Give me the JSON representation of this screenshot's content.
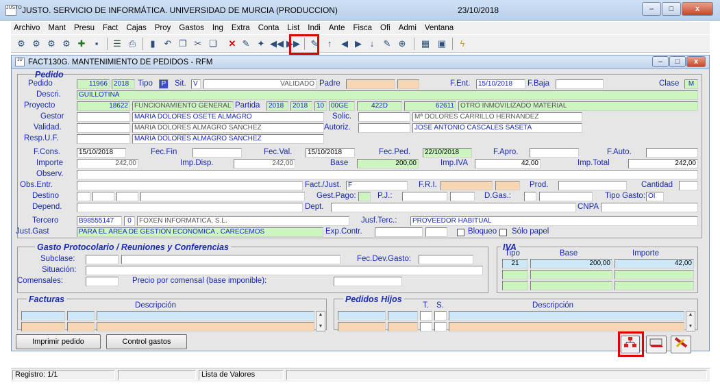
{
  "window": {
    "title": "JUSTO. SERVICIO DE INFORMÁTICA. UNIVERSIDAD DE MURCIA (PRODUCCION)",
    "date": "23/10/2018",
    "app_icon_text": "JUSTO",
    "minimize": "–",
    "maximize": "□",
    "close": "x"
  },
  "menu": [
    "Archivo",
    "Mant",
    "Presu",
    "Fact",
    "Cajas",
    "Proy",
    "Gastos",
    "Ing",
    "Extra",
    "Conta",
    "List",
    "Indi",
    "Ante",
    "Fisca",
    "Ofi",
    "Admi",
    "Ventana"
  ],
  "form": {
    "title": "FACT130G. MANTENIMIENTO DE PEDIDOS - RFM",
    "section_pedido": "Pedido",
    "labels": {
      "pedido": "Pedido",
      "tipo": "Tipo",
      "sit": "Sit.",
      "padre": "Padre",
      "fent": "F.Ent.",
      "fbaja": "F.Baja",
      "clase": "Clase",
      "descri": "Descri.",
      "proyecto": "Proyecto",
      "partida": "Partida",
      "gestor": "Gestor",
      "solic": "Solic.",
      "validad": "Validad.",
      "autoriz": "Autoriz.",
      "respuf": "Resp.U.F.",
      "fcons": "F.Cons.",
      "fecfin": "Fec.Fin",
      "fecval": "Fec.Val.",
      "fecped": "Fec.Ped.",
      "fapro": "F.Apro.",
      "fauto": "F.Auto.",
      "importe": "Importe",
      "impdisp": "Imp.Disp.",
      "base": "Base",
      "impiva": "Imp.IVA",
      "imptotal": "Imp.Total",
      "observ": "Observ.",
      "obsentr": "Obs.Entr.",
      "factjust": "Fact./Just.",
      "fri": "F.R.I.",
      "prod": "Prod.",
      "cantidad": "Cantidad",
      "destino": "Destino",
      "gestpago": "Gest.Pago:",
      "pj": "P.J.:",
      "dgas": "D.Gas.:",
      "tipogasto": "Tipo Gasto:",
      "depend": "Depend.",
      "dept": "Dept.",
      "cnpa": "CNPA",
      "tercero": "Tercero",
      "jusfterc": "Jusf.Terc.:",
      "justgast": "Just.Gast",
      "expcontr": "Exp.Contr.",
      "bloqueo": "Bloqueo",
      "solo_papel": "Sólo papel"
    },
    "values": {
      "pedido": "11966",
      "anio": "2018",
      "tipo": "P",
      "sit": "V",
      "sit_desc": "VALIDADO",
      "fent": "15/10/2018",
      "clase": "M",
      "descri": "GUILLOTINA",
      "proyecto": "18622",
      "proyecto_desc": "FUNCIONAMIENTO GENERAL DEL ÁR",
      "partida_1": "2018",
      "partida_2": "2018",
      "partida_3": "10",
      "partida_4": "00GE",
      "partida_5": "422D",
      "partida_6": "62611",
      "partida_desc": "OTRO INMOVILIZADO MATERIAL",
      "gestor": "MARIA DOLORES OSETE ALMAGRO",
      "solic": "Mª DOLORES CARRILLO HERNANDEZ",
      "validad": "MARIA DOLORES ALMAGRO SANCHEZ",
      "autoriz": "JOSE ANTONIO CASCALES SASETA",
      "respuf": "MARIA DOLORES ALMAGRO SANCHEZ",
      "fcons": "15/10/2018",
      "fecval": "15/10/2018",
      "fecped": "22/10/2018",
      "importe": "242,00",
      "impdisp": "242,00",
      "base": "200,00",
      "impiva": "42,00",
      "imptotal": "242,00",
      "factjust": "F",
      "tipogasto": "OI",
      "tercero": "B98555147",
      "tercero_num": "0",
      "tercero_desc": "FOXEN INFORMATICA, S.L.",
      "jusfterc": "PROVEEDOR HABITUAL",
      "justgast": "PARA EL ÁREA DE GESTIÓN ECONÓMICA . CARECEMOS"
    },
    "gasto": {
      "title": "Gasto Protocolario / Reuniones y Conferencias",
      "subclase": "Subclase:",
      "situacion": "Situación:",
      "comensales": "Comensales:",
      "precio": "Precio por comensal (base imponible):",
      "fecdev": "Fec.Dev.Gasto:"
    },
    "iva": {
      "title": "IVA",
      "col_tipo": "Tipo",
      "col_base": "Base",
      "col_importe": "Importe",
      "tipo": "21",
      "base": "200,00",
      "importe": "42,00"
    },
    "facturas": {
      "title": "Facturas",
      "col_desc": "Descripción"
    },
    "hijos": {
      "title": "Pedidos Hijos",
      "col_t": "T.",
      "col_s": "S.",
      "col_desc": "Descripción"
    },
    "buttons": {
      "imprimir": "Imprimir pedido",
      "control": "Control gastos"
    }
  },
  "status": {
    "registro": "Registro: 1/1",
    "lista": "Lista de Valores"
  },
  "colors": {
    "highlight": "#e00000",
    "label": "#1a2bb0",
    "green_field": "#ccf5c0",
    "peach_field": "#f7d6b4"
  }
}
